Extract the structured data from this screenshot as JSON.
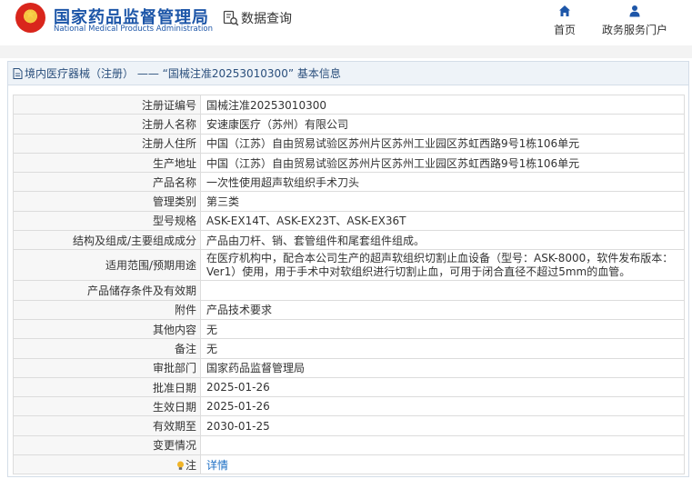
{
  "header": {
    "brand_cn": "国家药品监督管理局",
    "brand_en": "National Medical Products Administration",
    "data_search": "数据查询",
    "nav_home": "首页",
    "nav_portal": "政务服务门户",
    "brand_color": "#1d56a8"
  },
  "panel": {
    "title": "境内医疗器械（注册） —— “国械注准20253010300” 基本信息"
  },
  "details": {
    "rows": [
      {
        "label": "注册证编号",
        "value": "国械注准20253010300"
      },
      {
        "label": "注册人名称",
        "value": "安速康医疗（苏州）有限公司"
      },
      {
        "label": "注册人住所",
        "value": "中国（江苏）自由贸易试验区苏州片区苏州工业园区苏虹西路9号1栋106单元"
      },
      {
        "label": "生产地址",
        "value": "中国（江苏）自由贸易试验区苏州片区苏州工业园区苏虹西路9号1栋106单元"
      },
      {
        "label": "产品名称",
        "value": "一次性使用超声软组织手术刀头"
      },
      {
        "label": "管理类别",
        "value": "第三类"
      },
      {
        "label": "型号规格",
        "value": "ASK-EX14T、ASK-EX23T、ASK-EX36T"
      },
      {
        "label": "结构及组成/主要组成成分",
        "value": "产品由刀杆、销、套管组件和尾套组件组成。"
      },
      {
        "label": "适用范围/预期用途",
        "value": "在医疗机构中，配合本公司生产的超声软组织切割止血设备（型号：ASK-8000，软件发布版本：Ver1）使用，用于手术中对软组织进行切割止血，可用于闭合直径不超过5mm的血管。"
      },
      {
        "label": "产品储存条件及有效期",
        "value": ""
      },
      {
        "label": "附件",
        "value": "产品技术要求"
      },
      {
        "label": "其他内容",
        "value": "无"
      },
      {
        "label": "备注",
        "value": "无"
      },
      {
        "label": "审批部门",
        "value": "国家药品监督管理局"
      },
      {
        "label": "批准日期",
        "value": "2025-01-26"
      },
      {
        "label": "生效日期",
        "value": "2025-01-26"
      },
      {
        "label": "有效期至",
        "value": "2030-01-25"
      },
      {
        "label": "变更情况",
        "value": ""
      }
    ],
    "note_label": "注",
    "note_link": "详情"
  }
}
